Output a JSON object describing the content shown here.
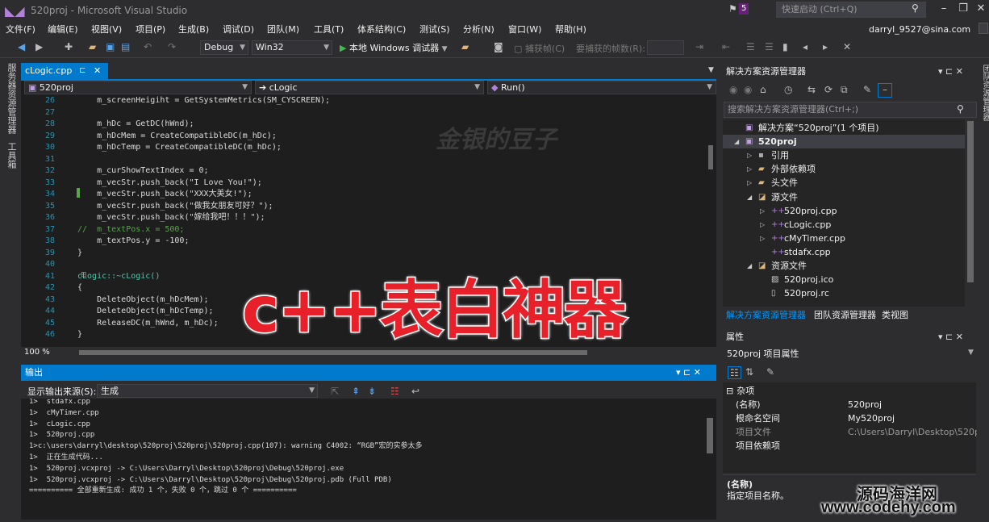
{
  "window": {
    "title": "520proj - Microsoft Visual Studio",
    "notifications": "5",
    "quick_launch_placeholder": "快速启动 (Ctrl+Q)"
  },
  "menu": [
    "文件(F)",
    "编辑(E)",
    "视图(V)",
    "项目(P)",
    "生成(B)",
    "调试(D)",
    "团队(M)",
    "工具(T)",
    "体系结构(C)",
    "测试(S)",
    "分析(N)",
    "窗口(W)",
    "帮助(H)"
  ],
  "account": "darryl_9527@sina.com",
  "toolbar": {
    "config": "Debug",
    "platform": "Win32",
    "run_label": "本地 Windows 调试器",
    "capture_frame": "捕获帧(C)",
    "frames_label": "要捕获的帧数(R):"
  },
  "left_strip": {
    "server_explorer": "服务器资源管理器",
    "toolbox": "工具箱"
  },
  "editor": {
    "tab": "cLogic.cpp",
    "nav_project": "520proj",
    "nav_class": "cLogic",
    "nav_member": "Run()",
    "zoom": "100 %",
    "watermark": "金银的豆子",
    "lines": [
      {
        "n": "26",
        "t": "    m_screenHeigiht = GetSystemMetrics(SM_CYSCREEN);"
      },
      {
        "n": "27",
        "t": ""
      },
      {
        "n": "28",
        "t": "    m_hDc = GetDC(hWnd);"
      },
      {
        "n": "29",
        "t": "    m_hDcMem = CreateCompatibleDC(m_hDc);"
      },
      {
        "n": "30",
        "t": "    m_hDcTemp = CreateCompatibleDC(m_hDc);"
      },
      {
        "n": "31",
        "t": ""
      },
      {
        "n": "32",
        "t": "    m_curShowTextIndex = 0;"
      },
      {
        "n": "33",
        "t": "    m_vecStr.push_back(\"I Love You!\");"
      },
      {
        "n": "34",
        "t": "    m_vecStr.push_back(\"XXX大美女!\");"
      },
      {
        "n": "35",
        "t": "    m_vecStr.push_back(\"做我女朋友可好？\");"
      },
      {
        "n": "36",
        "t": "    m_vecStr.push_back(\"嫁给我吧！！！\");"
      },
      {
        "n": "37",
        "t": "//  m_textPos.x = 500;"
      },
      {
        "n": "38",
        "t": "    m_textPos.y = -100;"
      },
      {
        "n": "39",
        "t": "}"
      },
      {
        "n": "40",
        "t": ""
      },
      {
        "n": "41",
        "t": "cLogic::~cLogic()"
      },
      {
        "n": "42",
        "t": "{"
      },
      {
        "n": "43",
        "t": "    DeleteObject(m_hDcMem);"
      },
      {
        "n": "44",
        "t": "    DeleteObject(m_hDcTemp);"
      },
      {
        "n": "45",
        "t": "    ReleaseDC(m_hWnd, m_hDc);"
      },
      {
        "n": "46",
        "t": "}"
      }
    ]
  },
  "overlay_title": "c++表白神器",
  "output": {
    "title": "输出",
    "source_label": "显示输出来源(S):",
    "source_value": "生成",
    "lines": [
      "1>  stdafx.cpp",
      "1>  cMyTimer.cpp",
      "1>  cLogic.cpp",
      "1>  520proj.cpp",
      "1>c:\\users\\darryl\\desktop\\520proj\\520proj\\520proj.cpp(107): warning C4002: “RGB”宏的实参太多",
      "1>  正在生成代码...",
      "1>  520proj.vcxproj -> C:\\Users\\Darryl\\Desktop\\520proj\\Debug\\520proj.exe",
      "1>  520proj.vcxproj -> C:\\Users\\Darryl\\Desktop\\520proj\\Debug\\520proj.pdb (Full PDB)",
      "========== 全部重新生成: 成功 1 个，失败 0 个，跳过 0 个 =========="
    ]
  },
  "solution_explorer": {
    "title": "解决方案资源管理器",
    "search_placeholder": "搜索解决方案资源管理器(Ctrl+;)",
    "tree": [
      {
        "label": "解决方案“520proj”(1 个项目)",
        "level": 0,
        "expand": "",
        "icon": "solution-icon",
        "sel": false
      },
      {
        "label": "520proj",
        "level": 0,
        "expand": "open",
        "icon": "project-icon",
        "sel": true
      },
      {
        "label": "引用",
        "level": 1,
        "expand": "closed",
        "icon": "references-icon",
        "sel": false
      },
      {
        "label": "外部依赖项",
        "level": 1,
        "expand": "closed",
        "icon": "folder-icon",
        "sel": false
      },
      {
        "label": "头文件",
        "level": 1,
        "expand": "closed",
        "icon": "folder-icon",
        "sel": false
      },
      {
        "label": "源文件",
        "level": 1,
        "expand": "open",
        "icon": "folder-open-icon",
        "sel": false
      },
      {
        "label": "520proj.cpp",
        "level": 2,
        "expand": "closed",
        "icon": "cpp-file-icon",
        "sel": false
      },
      {
        "label": "cLogic.cpp",
        "level": 2,
        "expand": "closed",
        "icon": "cpp-file-icon",
        "sel": false
      },
      {
        "label": "cMyTimer.cpp",
        "level": 2,
        "expand": "closed",
        "icon": "cpp-file-icon",
        "sel": false
      },
      {
        "label": "stdafx.cpp",
        "level": 2,
        "expand": "",
        "icon": "cpp-file-icon",
        "sel": false
      },
      {
        "label": "资源文件",
        "level": 1,
        "expand": "open",
        "icon": "folder-open-icon",
        "sel": false
      },
      {
        "label": "520proj.ico",
        "level": 2,
        "expand": "",
        "icon": "image-file-icon",
        "sel": false
      },
      {
        "label": "520proj.rc",
        "level": 2,
        "expand": "",
        "icon": "file-icon",
        "sel": false
      }
    ],
    "tabs": [
      "解决方案资源管理器",
      "团队资源管理器",
      "类视图"
    ]
  },
  "properties": {
    "title": "属性",
    "object": "520proj  项目属性",
    "category": "杂项",
    "rows": [
      {
        "k": "(名称)",
        "v": "520proj",
        "dim": false
      },
      {
        "k": "根命名空间",
        "v": "My520proj",
        "dim": false
      },
      {
        "k": "项目文件",
        "v": "C:\\Users\\Darryl\\Desktop\\520proj",
        "dim": true
      },
      {
        "k": "项目依赖项",
        "v": "",
        "dim": false
      }
    ],
    "desc_title": "(名称)",
    "desc_text": "指定项目名称。"
  },
  "right_strip": {
    "team_explorer": "团队资源管理器"
  },
  "site_watermark": {
    "line1": "源码海洋网",
    "line2": "www.codehy.com"
  },
  "colors": {
    "accent": "#007acc",
    "overlay_red": "#e8202a",
    "editor_bg": "#1e1e1e",
    "chrome_bg": "#2d2d30"
  }
}
